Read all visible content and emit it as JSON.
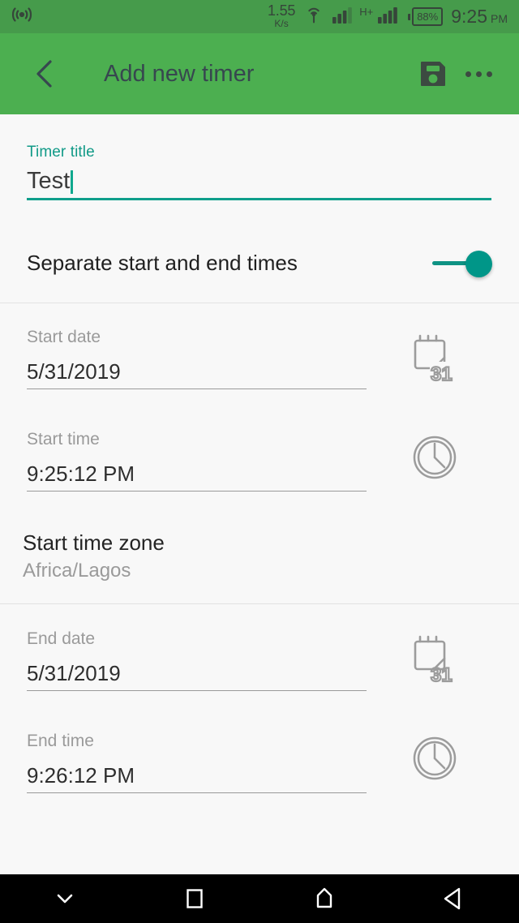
{
  "status_bar": {
    "left_icon": "wifi-broadcast-icon",
    "net_speed_rate": "1.55",
    "net_speed_unit": "K/s",
    "hotspot_icon": "hotspot-icon",
    "sim1_icon": "signal-bars-icon",
    "network_type": "H+",
    "sim2_icon": "signal-bars-icon",
    "battery_text": "88%",
    "clock_time": "9:25",
    "clock_meridiem": "PM",
    "bg_color": "#469b4b",
    "ink_color": "#36453a"
  },
  "app_bar": {
    "back_icon": "chevron-left-icon",
    "title": "Add new timer",
    "save_icon": "floppy-save-icon",
    "overflow_icon": "more-vertical-dots-icon",
    "bg_color": "#4caf50",
    "ink_color": "#37474f"
  },
  "form": {
    "accent_color": "#0f9e8b",
    "timer_title": {
      "label": "Timer title",
      "value": "Test",
      "placeholder": "Timer title",
      "focused": true
    },
    "separate_times": {
      "label": "Separate start and end times",
      "state": "on",
      "thumb_color": "#009688"
    },
    "start_date": {
      "label": "Start date",
      "value": "5/31/2019",
      "icon": "calendar-31-icon"
    },
    "start_time": {
      "label": "Start time",
      "value": "9:25:12 PM",
      "icon": "clock-icon"
    },
    "start_time_zone": {
      "label": "Start time zone",
      "value": "Africa/Lagos"
    },
    "end_date": {
      "label": "End date",
      "value": "5/31/2019",
      "icon": "calendar-31-icon"
    },
    "end_time": {
      "label": "End time",
      "value": "9:26:12 PM",
      "icon": "clock-icon"
    }
  },
  "nav_bar": {
    "hide_keyboard_icon": "chevron-down-icon",
    "recents_icon": "square-recents-icon",
    "home_icon": "home-pentagon-icon",
    "back_icon": "triangle-back-icon",
    "bg_color": "#000000"
  }
}
